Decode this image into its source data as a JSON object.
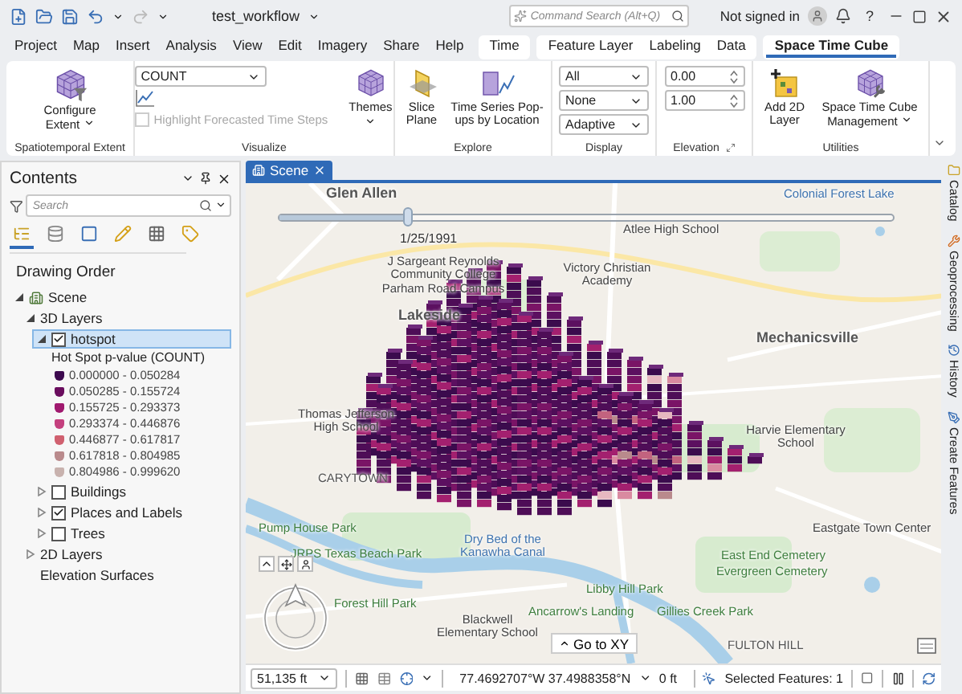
{
  "title_bar": {
    "title": "test_workflow",
    "search_placeholder": "Command Search (Alt+Q)",
    "user": "Not signed in",
    "help": "?"
  },
  "tab_groups": [
    {
      "kind": "main",
      "tabs": [
        {
          "label": "Project",
          "selected": false
        },
        {
          "label": "Map",
          "selected": false
        },
        {
          "label": "Insert",
          "selected": false
        },
        {
          "label": "Analysis",
          "selected": false
        },
        {
          "label": "View",
          "selected": false
        },
        {
          "label": "Edit",
          "selected": false
        },
        {
          "label": "Imagery",
          "selected": false
        },
        {
          "label": "Share",
          "selected": false
        },
        {
          "label": "Help",
          "selected": false
        }
      ]
    },
    {
      "kind": "contextual",
      "tabs": [
        {
          "label": "Time",
          "selected": false
        }
      ]
    },
    {
      "kind": "contextual",
      "tabs": [
        {
          "label": "Feature Layer",
          "selected": false
        },
        {
          "label": "Labeling",
          "selected": false
        },
        {
          "label": "Data",
          "selected": false
        }
      ]
    },
    {
      "kind": "contextual",
      "tabs": [
        {
          "label": "Space Time Cube",
          "selected": true
        }
      ]
    }
  ],
  "ribbon": {
    "groups": [
      {
        "kind": "extent",
        "label": "Spatiotemporal Extent",
        "button": "Configure Extent"
      },
      {
        "kind": "visualize",
        "label": "Visualize",
        "variable": "COUNT",
        "checkbox": {
          "label": "Highlight Forecasted Time Steps",
          "checked": false,
          "disabled": true
        },
        "themes": "Themes"
      },
      {
        "kind": "explore",
        "label": "Explore",
        "buttons": [
          "Slice Plane",
          "Time Series Pop-ups by Location"
        ]
      },
      {
        "kind": "display",
        "label": "Display",
        "dropdowns": [
          "All",
          "None",
          "Adaptive"
        ]
      },
      {
        "kind": "elevation",
        "label": "Elevation",
        "spinners": [
          "0.00",
          "1.00"
        ]
      },
      {
        "kind": "utilities",
        "label": "Utilities",
        "buttons": [
          "Add 2D Layer",
          "Space Time Cube Management"
        ]
      }
    ]
  },
  "contents": {
    "title": "Contents",
    "search_placeholder": "Search",
    "view_tabs": [
      {
        "selected": true
      },
      {
        "selected": false
      },
      {
        "selected": false
      },
      {
        "selected": false
      },
      {
        "selected": false
      },
      {
        "selected": false
      }
    ],
    "heading": "Drawing Order",
    "tree": [
      {
        "label": "Scene",
        "kind": "scene",
        "expanded": true,
        "selected": false,
        "children": [
          {
            "label": "3D Layers",
            "kind": "group",
            "expanded": true,
            "selected": false,
            "children": [
              {
                "label": "hotspot",
                "kind": "layer",
                "expanded": true,
                "checked": true,
                "selected": true,
                "legend": {
                  "title": "Hot Spot p-value (COUNT)",
                  "items": [
                    {
                      "label": "0.000000 - 0.050284",
                      "color": "#3d0a4f"
                    },
                    {
                      "label": "0.050285 - 0.155724",
                      "color": "#6a0d5e"
                    },
                    {
                      "label": "0.155725 - 0.293373",
                      "color": "#a0196f"
                    },
                    {
                      "label": "0.293374 - 0.446876",
                      "color": "#c4407e"
                    },
                    {
                      "label": "0.446877 - 0.617817",
                      "color": "#d0606f"
                    },
                    {
                      "label": "0.617818 - 0.804985",
                      "color": "#b98a8c"
                    },
                    {
                      "label": "0.804986 - 0.999620",
                      "color": "#c8b2ae"
                    }
                  ]
                }
              },
              {
                "label": "Buildings",
                "kind": "layer",
                "expanded": false,
                "checked": false,
                "selected": false
              },
              {
                "label": "Places and Labels",
                "kind": "layer",
                "expanded": false,
                "checked": true,
                "selected": false
              },
              {
                "label": "Trees",
                "kind": "layer",
                "expanded": false,
                "checked": false,
                "selected": false
              }
            ]
          },
          {
            "label": "2D Layers",
            "kind": "group",
            "expanded": false,
            "selected": false
          },
          {
            "label": "Elevation Surfaces",
            "kind": "plain",
            "selected": false
          }
        ]
      }
    ]
  },
  "views": [
    {
      "label": "Scene",
      "selected": true
    }
  ],
  "map": {
    "time_slider": {
      "date": "1/25/1991",
      "level": 0.21
    },
    "labels": [
      {
        "text": "Glen Allen",
        "kind": "town"
      },
      {
        "text": "Colonial Forest Lake",
        "kind": "water"
      },
      {
        "text": "Atlee High School",
        "kind": "poi"
      },
      {
        "text": "J Sargeant Reynolds Community College Parham Road Campus",
        "kind": "poi"
      },
      {
        "text": "Victory Christian Academy",
        "kind": "poi"
      },
      {
        "text": "Lakeside",
        "kind": "town"
      },
      {
        "text": "Mechanicsville",
        "kind": "town"
      },
      {
        "text": "Thomas Jefferson High School",
        "kind": "poi"
      },
      {
        "text": "Harvie Elementary School",
        "kind": "poi"
      },
      {
        "text": "CARYTOWN",
        "kind": "district"
      },
      {
        "text": "Pump House Park",
        "kind": "park"
      },
      {
        "text": "Eastgate Town Center",
        "kind": "poi"
      },
      {
        "text": "JRPS Texas Beach Park",
        "kind": "park"
      },
      {
        "text": "Dry Bed of the Kanawha Canal",
        "kind": "water"
      },
      {
        "text": "East End Cemetery",
        "kind": "park"
      },
      {
        "text": "Evergreen Cemetery",
        "kind": "park"
      },
      {
        "text": "Libby Hill Park",
        "kind": "park"
      },
      {
        "text": "Forest Hill Park",
        "kind": "park"
      },
      {
        "text": "Ancarrow's Landing",
        "kind": "park"
      },
      {
        "text": "Gillies Creek Park",
        "kind": "park"
      },
      {
        "text": "Blackwell Elementary School",
        "kind": "poi"
      },
      {
        "text": "FULTON HILL",
        "kind": "district"
      }
    ],
    "go_to_xy": "Go to XY"
  },
  "status_bar": {
    "scale": "51,135 ft",
    "coordinates": "77.4692707°W 37.4988358°N",
    "elevation": "0 ft",
    "selection": "Selected Features: 1"
  },
  "dock": [
    "Catalog",
    "Geoprocessing",
    "History",
    "Create Features"
  ]
}
